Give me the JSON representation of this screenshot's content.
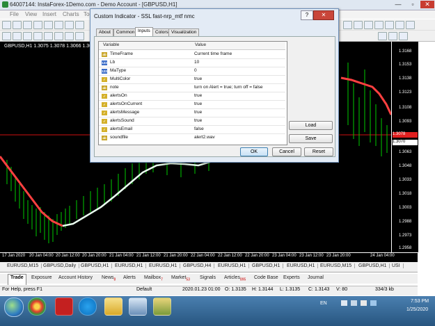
{
  "app": {
    "title": "64007144: InstaForex-1Demo.com - Demo Account - [GBPUSD,H1]",
    "min": "—",
    "max": "▫",
    "close": "✕"
  },
  "menu": [
    "File",
    "View",
    "Insert",
    "Charts",
    "Tools"
  ],
  "chart": {
    "header": "GBPUSD,H1  1.3075 1.3078 1.3066 1.3070",
    "price_labels": [
      "1.3168",
      "1.3153",
      "1.3138",
      "1.3123",
      "1.3108",
      "1.3093",
      "1.3078",
      "1.3070",
      "1.3063",
      "1.3048",
      "1.3033",
      "1.3018",
      "1.3003",
      "1.2988",
      "1.2973",
      "1.2958"
    ],
    "time_labels": [
      "17 Jan 2020",
      "20 Jan 04:00",
      "20 Jan 12:00",
      "20 Jan 20:00",
      "21 Jan 04:00",
      "21 Jan 12:00",
      "21 Jan 20:00",
      "22 Jan 04:00",
      "22 Jan 12:00",
      "22 Jan 20:00",
      "23 Jan 04:00",
      "23 Jan 12:00",
      "23 Jan 20:00",
      "24 Jan 04:00"
    ],
    "current_red": "1.3078",
    "current_white": "1.3070"
  },
  "symbol_tabs": [
    "EURUSD,M15",
    "GBPUSD,Daily",
    "GBPUSD,H1",
    "EURUSD,H1",
    "EURUSD,H1",
    "GBPUSD,H4",
    "EURUSD,H1",
    "GBPUSD,H1",
    "EURUSD,H1",
    "EURUSD,M15",
    "GBPUSD,H1",
    "USI"
  ],
  "terminal_tabs": [
    {
      "label": "Trade",
      "badge": ""
    },
    {
      "label": "Exposure",
      "badge": ""
    },
    {
      "label": "Account History",
      "badge": ""
    },
    {
      "label": "News",
      "badge": "8"
    },
    {
      "label": "Alerts",
      "badge": ""
    },
    {
      "label": "Mailbox",
      "badge": "7"
    },
    {
      "label": "Market",
      "badge": "53"
    },
    {
      "label": "Signals",
      "badge": ""
    },
    {
      "label": "Articles",
      "badge": "895"
    },
    {
      "label": "Code Base",
      "badge": ""
    },
    {
      "label": "Experts",
      "badge": ""
    },
    {
      "label": "Journal",
      "badge": ""
    }
  ],
  "status": {
    "help": "For Help, press F1",
    "profile": "Default",
    "datetime": "2020.01.23 01:00",
    "open": "O: 1.3135",
    "high": "H: 1.3144",
    "low": "L: 1.3135",
    "close": "C: 1.3143",
    "volume": "V: 80",
    "traffic": "334/3 kb"
  },
  "taskbar": {
    "lang": "EN",
    "time": "7:53 PM",
    "date": "1/25/2020"
  },
  "dialog": {
    "title": "Custom Indicator - SSL fast-nrp_mtf nmc",
    "help": "?",
    "close": "✕",
    "tabs": [
      "About",
      "Common",
      "Inputs",
      "Colors",
      "Visualization"
    ],
    "active_tab": "Inputs",
    "col_variable": "Variable",
    "col_value": "Value",
    "rows": [
      {
        "icon": "ab",
        "name": "TimeFrame",
        "value": "Current time frame"
      },
      {
        "icon": "123",
        "name": "Lb",
        "value": "10"
      },
      {
        "icon": "123",
        "name": "MaType",
        "value": "0"
      },
      {
        "icon": "bool",
        "name": "MultiColor",
        "value": "true"
      },
      {
        "icon": "ab",
        "name": "note",
        "value": "turn on Alert = true; turn off = false"
      },
      {
        "icon": "bool",
        "name": "alertsOn",
        "value": "true"
      },
      {
        "icon": "bool",
        "name": "alertsOnCurrent",
        "value": "true"
      },
      {
        "icon": "bool",
        "name": "alertsMessage",
        "value": "true"
      },
      {
        "icon": "bool",
        "name": "alertsSound",
        "value": "true"
      },
      {
        "icon": "bool",
        "name": "alertsEmail",
        "value": "false"
      },
      {
        "icon": "ab",
        "name": "soundfile",
        "value": "alert2.wav"
      }
    ],
    "load": "Load",
    "save": "Save",
    "ok": "OK",
    "cancel": "Cancel",
    "reset": "Reset"
  }
}
